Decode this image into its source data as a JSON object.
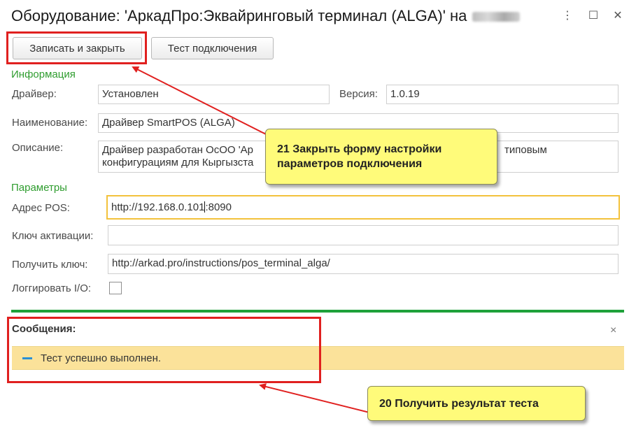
{
  "window": {
    "title": "Оборудование: 'АркадПро:Эквайринговый терминал (ALGA)' на",
    "more_icon": "more-icon",
    "maximize_icon": "maximize-icon",
    "close_icon": "close-icon"
  },
  "toolbar": {
    "save_close_label": "Записать и закрыть",
    "test_connection_label": "Тест подключения"
  },
  "info": {
    "section_title": "Информация",
    "driver_label": "Драйвер:",
    "driver_value": "Установлен",
    "version_label": "Версия:",
    "version_value": "1.0.19",
    "name_label": "Наименование:",
    "name_value": "Драйвер SmartPOS (ALGA)",
    "description_label": "Описание:",
    "description_line1": "Драйвер разработан ОсОО 'Ар",
    "description_line1_end": "типовым",
    "description_line2": "конфигурациям для Кыргызста"
  },
  "params": {
    "section_title": "Параметры",
    "pos_address_label": "Адрес POS:",
    "pos_address_value_before": "http://192.168.0.101",
    "pos_address_value_after": ":8090",
    "activation_key_label": "Ключ активации:",
    "activation_key_value": "",
    "get_key_label": "Получить ключ:",
    "get_key_value": "http://arkad.pro/instructions/pos_terminal_alga/",
    "log_io_label": "Логгировать I/O:",
    "log_io_checked": false
  },
  "messages": {
    "title": "Сообщения:",
    "close_icon": "×",
    "items": [
      "Тест успешно выполнен."
    ]
  },
  "callouts": {
    "c21_line1": "21 Закрыть форму настройки",
    "c21_line2": "параметров подключения",
    "c20": "20 Получить результат теста"
  },
  "colors": {
    "section_green": "#2f9d2f",
    "divider_green": "#1ea13a",
    "message_bg": "#fbe29a",
    "callout_bg": "#fffb7a",
    "highlight_red": "#e0201f",
    "focus_border": "#f3c23c"
  }
}
